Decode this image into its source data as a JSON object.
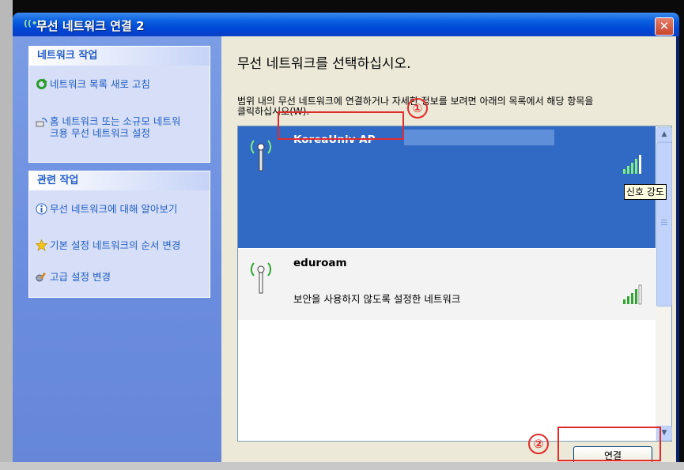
{
  "window": {
    "title": "무선 네트워크 연결 2",
    "title_icon": "wireless-signal-icon",
    "close_label": "✕"
  },
  "sidebar": {
    "network_tasks": {
      "header": "네트워크 작업",
      "items": [
        {
          "label": "네트워크 목록 새로 고침",
          "icon": "refresh-icon"
        },
        {
          "label_line1": "홈 네트워크 또는 소규모 네트워",
          "label_line2": "크용 무선 네트워크 설정",
          "icon": "wireless-setup-icon"
        }
      ]
    },
    "related_tasks": {
      "header": "관련 작업",
      "items": [
        {
          "label": "무선 네트워크에 대해 알아보기",
          "icon": "info-icon"
        },
        {
          "label": "기본 설정 네트워크의 순서 변경",
          "icon": "star-icon"
        },
        {
          "label": "고급 설정 변경",
          "icon": "settings-icon"
        }
      ]
    }
  },
  "main": {
    "heading": "무선 네트워크를 선택하십시오.",
    "instruction_line1": "범위 내의 무선 네트워크에 연결하거나 자세한 정보를 보려면 아래의 목록에서 해당 항목을",
    "instruction_line2": "클릭하십시오(W).",
    "networks": [
      {
        "ssid": "KoreaUniv AP",
        "description": "",
        "selected": true,
        "signal_bars": 5
      },
      {
        "ssid": "eduroam",
        "description": "보안을 사용하지 않도록 설정한 네트워크",
        "selected": false,
        "signal_bars": 5
      }
    ],
    "tooltip": "신호 강도",
    "connect_button": "연결"
  },
  "annotations": {
    "marker1": "①",
    "marker2": "②",
    "highlight_color": "#e22b2b"
  },
  "colors": {
    "title_bar": "#0a5fe0",
    "sidebar": "#6a8cdf",
    "selected_row": "#316ac5",
    "signal_green": "#2fa62f"
  }
}
